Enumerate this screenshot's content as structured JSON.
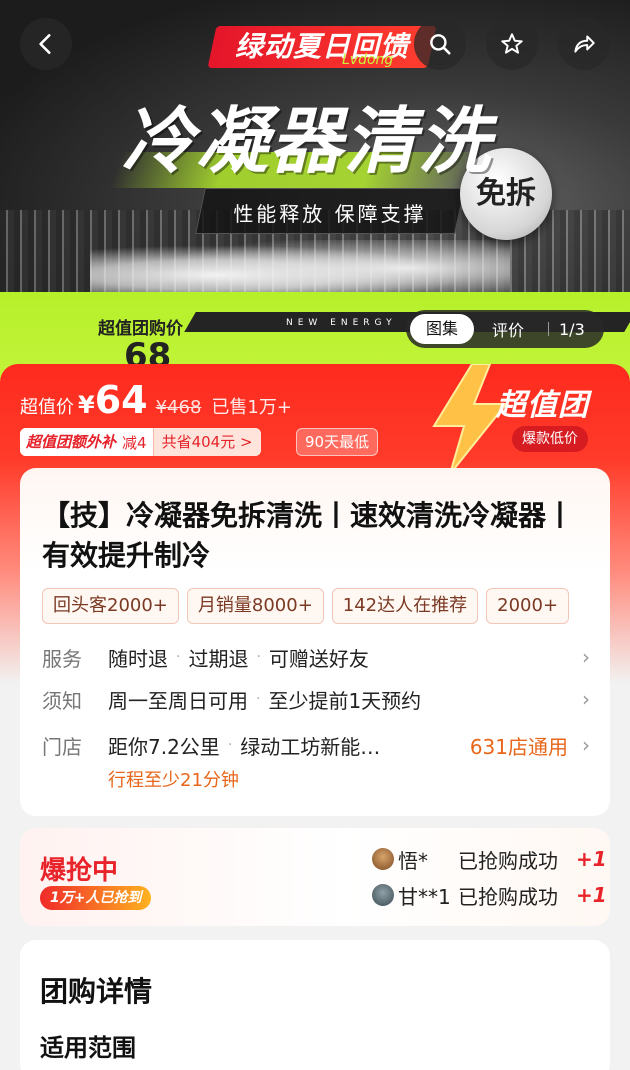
{
  "hero": {
    "promo": "绿动夏日回馈",
    "promo_sub": "Lvdong",
    "title": "冷凝器清洗",
    "subtitle": "性能释放 保障支撑",
    "badge": "免拆",
    "band_text": "NEW ENERGY",
    "peek_label": "超值团购价",
    "peek_price": "68",
    "gallery_tabs": [
      "图集",
      "评价"
    ],
    "gallery_counter": "1/3"
  },
  "price": {
    "label": "超值价",
    "currency": "¥",
    "value": "64",
    "original": "¥468",
    "sold": "已售1万+",
    "subsidy_label": "超值团额外补",
    "subsidy_discount": "减4",
    "saving": "共省404元 >",
    "low_tag": "90天最低",
    "super_tuan": "超值团",
    "super_tuan_tag": "爆款低价"
  },
  "product": {
    "title": "【技】冷凝器免拆清洗丨速效清洗冷凝器丨有效提升制冷",
    "stats": [
      "回头客2000+",
      "月销量8000+",
      "142达人在推荐",
      "2000+"
    ]
  },
  "service": {
    "key": "服务",
    "items": [
      "随时退",
      "过期退",
      "可赠送好友"
    ]
  },
  "notice": {
    "key": "须知",
    "items": [
      "周一至周日可用",
      "至少提前1天预约"
    ]
  },
  "store": {
    "key": "门店",
    "distance": "距你7.2公里",
    "name": "绿动工坊新能…",
    "link": "631店通用",
    "travel": "行程至少21分钟"
  },
  "flash": {
    "title": "爆抢中",
    "pill": "1万+人已抢到",
    "buyers": [
      {
        "name": "悟*",
        "status": "已抢购成功",
        "plus": "+1"
      },
      {
        "name": "甘**1",
        "status": "已抢购成功",
        "plus": "+1"
      }
    ]
  },
  "details": {
    "title": "团购详情",
    "subtitle": "适用范围"
  },
  "colors": {
    "accent": "#fe2a1e",
    "lime": "#b6f02a",
    "orange_link": "#e8661a"
  },
  "icons": [
    "back-icon",
    "search-icon",
    "star-icon",
    "share-icon",
    "bolt-icon",
    "chevron-right-icon"
  ]
}
